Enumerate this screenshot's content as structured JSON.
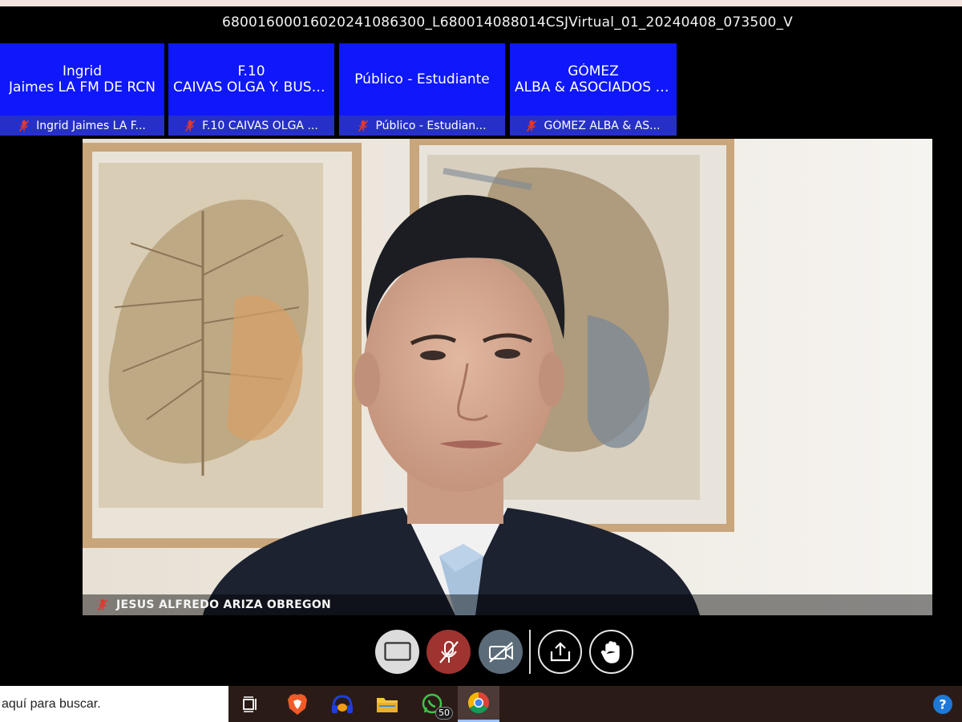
{
  "meeting": {
    "title": "68001600016020241086300_L680014088014CSJVirtual_01_20240408_073500_V"
  },
  "participants": [
    {
      "line1": "Ingrid",
      "line2": "Jaimes LA FM DE RCN",
      "footer": "Ingrid Jaimes LA F...",
      "mic": "muted"
    },
    {
      "line1": "F.10",
      "line2": "CAIVAS OLGA Y. BUST...",
      "footer": "F.10 CAIVAS OLGA ...",
      "mic": "muted"
    },
    {
      "line1": "Público - Estudiante",
      "line2": "",
      "footer": "Público - Estudian...",
      "mic": "muted"
    },
    {
      "line1": "GÓMEZ",
      "line2": "ALBA & ASOCIADOS - ...",
      "footer": "GÓMEZ ALBA & AS...",
      "mic": "muted"
    }
  ],
  "main_video": {
    "speaker_name": "JESUS ALFREDO ARIZA OBREGON",
    "mic": "muted"
  },
  "controls": [
    {
      "name": "layout-button",
      "icon": "screen-layout-icon"
    },
    {
      "name": "microphone-button",
      "icon": "microphone-off-icon",
      "state": "muted"
    },
    {
      "name": "camera-button",
      "icon": "camera-off-icon",
      "state": "off"
    },
    {
      "name": "share-screen-button",
      "icon": "share-upload-icon"
    },
    {
      "name": "raise-hand-button",
      "icon": "hand-icon"
    }
  ],
  "taskbar": {
    "search_placeholder": "aquí para buscar.",
    "apps": [
      {
        "name": "task-view",
        "icon": "task-view-icon"
      },
      {
        "name": "brave",
        "icon": "brave-lion-icon"
      },
      {
        "name": "audio-app",
        "icon": "headphones-icon"
      },
      {
        "name": "file-explorer",
        "icon": "folder-icon"
      },
      {
        "name": "whatsapp",
        "icon": "whatsapp-icon",
        "badge": "50"
      },
      {
        "name": "chrome",
        "icon": "chrome-icon",
        "active": true
      }
    ],
    "help_icon": "help-question-icon"
  },
  "colors": {
    "tile_bg": "#0f17fb",
    "tile_footer": "#2630c8",
    "muted_red": "#e0392d",
    "background": "#000000",
    "taskbar": "#2b1b17"
  }
}
